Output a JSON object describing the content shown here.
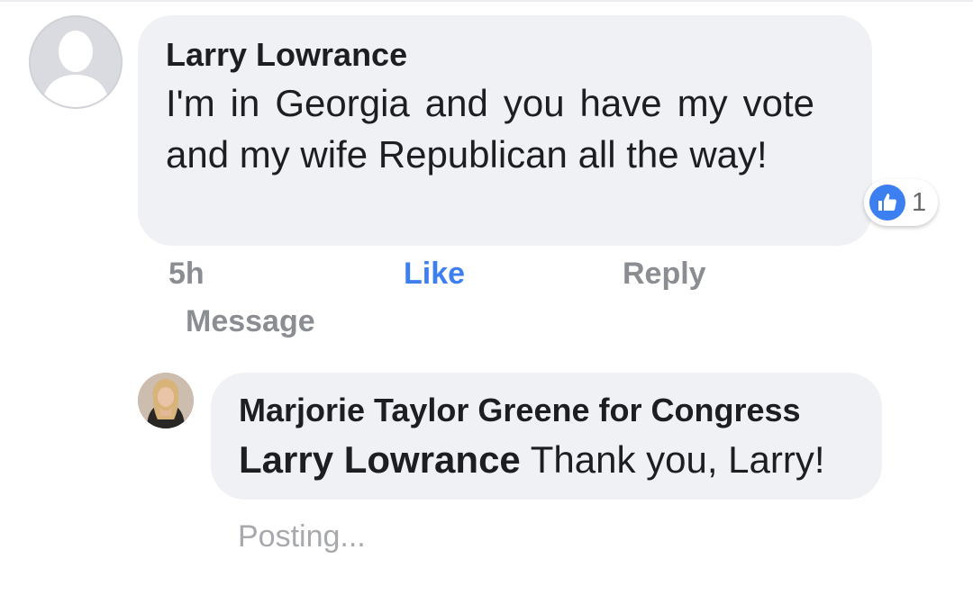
{
  "comment": {
    "author": "Larry Lowrance",
    "text": "I'm in Georgia and you have my vote and my wife Republican all the way!",
    "reaction_count": "1",
    "time": "5h",
    "like_label": "Like",
    "reply_label": "Reply",
    "message_label": "Message",
    "reaction_icon": "thumbs-up-icon"
  },
  "reply": {
    "author": "Marjorie Taylor Greene for Congress",
    "mention": "Larry Lowrance",
    "text": " Thank you, Larry!",
    "status": "Posting..."
  },
  "colors": {
    "bubble": "#f0f1f5",
    "like_blue": "#3b7ff0",
    "meta_gray": "#8a8d91"
  }
}
